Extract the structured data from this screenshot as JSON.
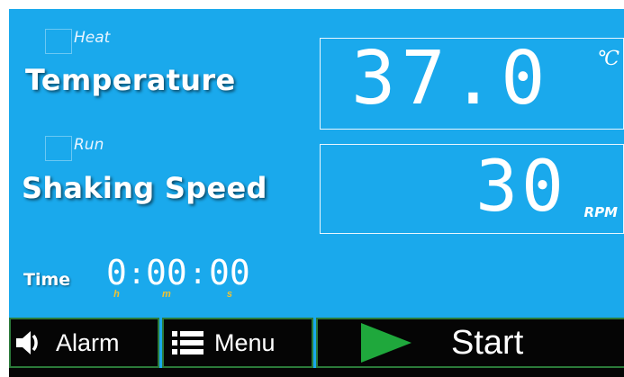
{
  "heat": {
    "label": "Heat"
  },
  "run": {
    "label": "Run"
  },
  "temperature": {
    "label": "Temperature",
    "value": "37.0",
    "unit": "℃"
  },
  "shaking_speed": {
    "label": "Shaking Speed",
    "value": "30",
    "unit": "RPM"
  },
  "time": {
    "label": "Time",
    "hours": "0",
    "hours_unit": "h",
    "minutes": "00",
    "minutes_unit": "m",
    "seconds": "00",
    "seconds_unit": "s",
    "separator": ":"
  },
  "buttons": {
    "alarm": "Alarm",
    "menu": "Menu",
    "start": "Start"
  },
  "colors": {
    "background": "#1aa9ec",
    "button_bg": "#050505",
    "start_accent": "#1fa83c",
    "time_unit": "#f2c230"
  },
  "icons": {
    "alarm": "speaker-icon",
    "menu": "list-icon",
    "start": "play-icon"
  }
}
